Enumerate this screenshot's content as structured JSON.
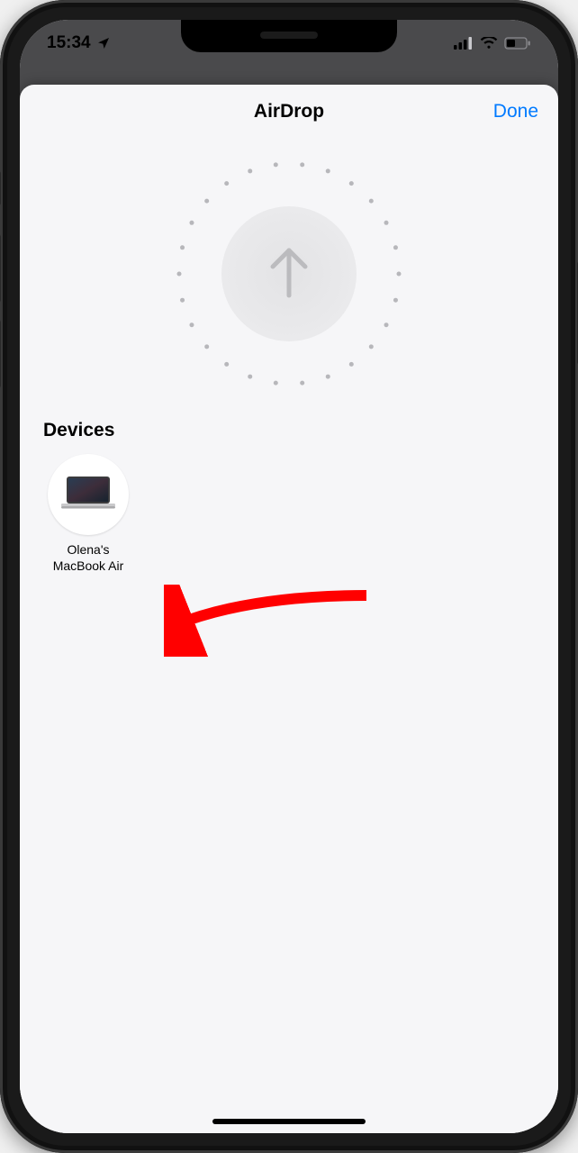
{
  "status": {
    "time": "15:34",
    "location_glyph": "location-arrow-icon"
  },
  "sheet": {
    "title": "AirDrop",
    "done_label": "Done",
    "section_label": "Devices",
    "devices": [
      {
        "name": "Olena's\nMacBook Air",
        "kind": "macbook-air"
      }
    ]
  },
  "annotation": {
    "arrow_color": "#ff0000"
  }
}
